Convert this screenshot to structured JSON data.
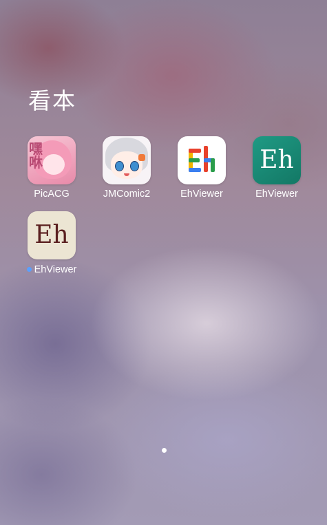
{
  "folder": {
    "title": "看本"
  },
  "apps": [
    {
      "label": "PicACG",
      "icon": "picacg-app-icon",
      "badge": false
    },
    {
      "label": "JMComic2",
      "icon": "jmcomic-app-icon",
      "badge": false
    },
    {
      "label": "EhViewer",
      "icon": "ehviewer-colorful-app-icon",
      "badge": false
    },
    {
      "label": "EhViewer",
      "icon": "ehviewer-teal-app-icon",
      "badge": false,
      "icon_text": "Eh"
    },
    {
      "label": "EhViewer",
      "icon": "ehviewer-cream-app-icon",
      "badge": true,
      "icon_text": "Eh"
    }
  ],
  "pager": {
    "pages": 1,
    "current": 1
  },
  "colors": {
    "badge": "#5aa0ff",
    "eh_teal": "#1f9a84",
    "eh_cream": "#ece5d3",
    "eh_cream_text": "#5a1f1f"
  }
}
